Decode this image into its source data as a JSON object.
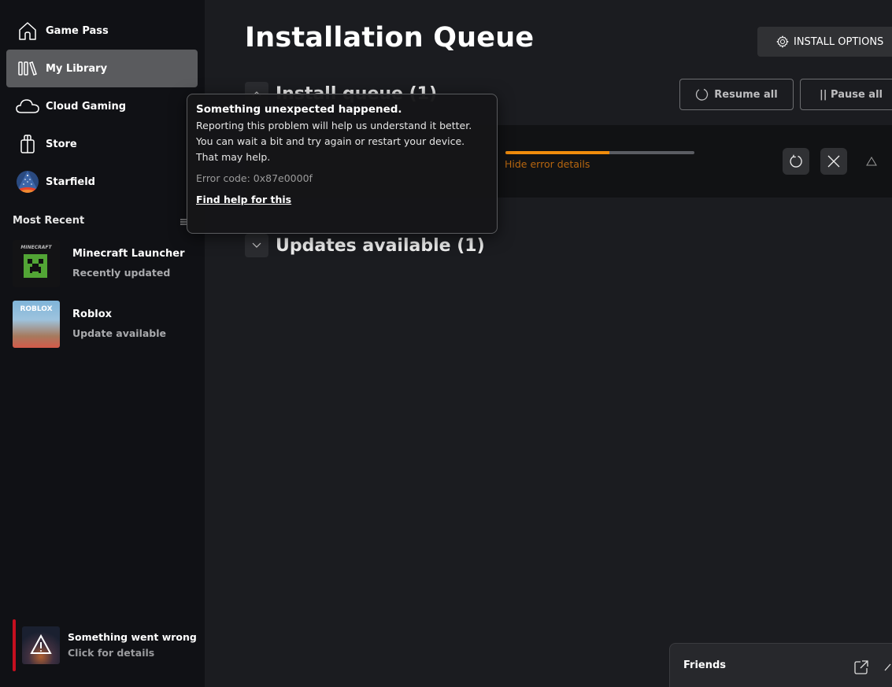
{
  "sidebar": {
    "nav": [
      {
        "label": "Game Pass",
        "icon": "home-icon"
      },
      {
        "label": "My Library",
        "icon": "library-icon",
        "active": true
      },
      {
        "label": "Cloud Gaming",
        "icon": "cloud-icon"
      },
      {
        "label": "Store",
        "icon": "store-bag-icon"
      },
      {
        "label": "Starfield",
        "icon": "starfield-game-icon"
      }
    ],
    "most_recent_label": "Most Recent",
    "recent": [
      {
        "title": "Minecraft Launcher",
        "subtitle": "Recently updated",
        "thumb_text": "MINECRAFT"
      },
      {
        "title": "Roblox",
        "subtitle": "Update available",
        "thumb_text": "ROBLOX"
      }
    ],
    "notification": {
      "title": "Something went wrong",
      "subtitle": "Click for details",
      "accent": "#c50f1f"
    }
  },
  "main": {
    "title": "Installation Queue",
    "install_options_label": "INSTALL OPTIONS",
    "install_queue": {
      "title": "Install queue (1)",
      "resume_all_label": "Resume all",
      "pause_all_label": "|| Pause all",
      "item": {
        "progress_percent": 55,
        "progress_color": "#f08c0c",
        "hide_details_label": "Hide error details"
      }
    },
    "updates": {
      "title": "Updates available (1)"
    }
  },
  "tooltip": {
    "title": "Something unexpected happened.",
    "body": "Reporting this problem will help us understand it better. You can wait a bit and try again or restart your device. That may help.",
    "error_code": "Error code: 0x87e0000f",
    "link": "Find help for this"
  },
  "friends": {
    "label": "Friends"
  }
}
